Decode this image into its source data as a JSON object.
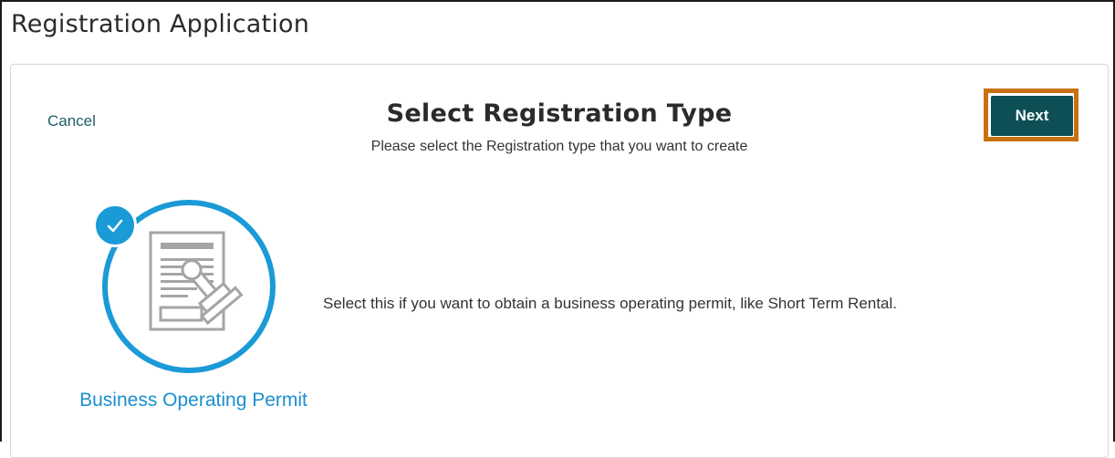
{
  "header": {
    "title": "Registration Application"
  },
  "toolbar": {
    "cancel_label": "Cancel",
    "next_label": "Next",
    "highlight_color": "#c9700f",
    "next_bg_color": "#0d4f55"
  },
  "main": {
    "heading": "Select Registration Type",
    "subtitle": "Please select the Registration type that you want to create",
    "options": [
      {
        "label": "Business Operating Permit",
        "description": "Select this if you want to obtain a business operating permit, like Short Term Rental.",
        "selected": true,
        "icon": "permit-document-stamp-icon",
        "accent_color": "#1a9ad6"
      }
    ]
  }
}
